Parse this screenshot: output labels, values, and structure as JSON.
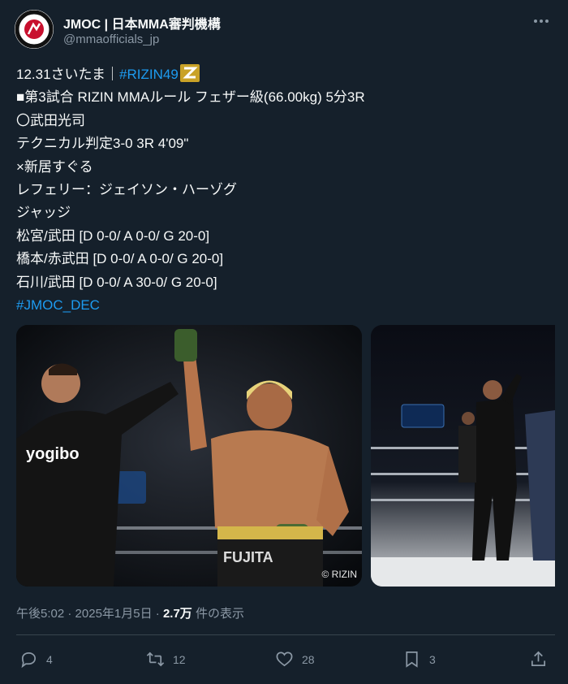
{
  "author": {
    "display_name": "JMOC | 日本MMA審判機構",
    "handle": "@mmaofficials_jp"
  },
  "tweet": {
    "lines": [
      {
        "text": "12.31さいたま｜"
      },
      {
        "text": "■第3試合 RIZIN MMAルール フェザー級(66.00kg) 5分3R"
      },
      {
        "text": "〇武田光司"
      },
      {
        "text": "テクニカル判定3-0  3R 4'09\""
      },
      {
        "text": "×新居すぐる"
      },
      {
        "text": "レフェリー：ジェイソン・ハーゾグ"
      },
      {
        "text": "ジャッジ"
      },
      {
        "text": "松宮/武田 [D 0-0/ A 0-0/ G 20-0]"
      },
      {
        "text": "橋本/赤武田 [D 0-0/ A 0-0/ G 20-0]"
      },
      {
        "text": "石川/武田 [D 0-0/ A 30-0/ G 20-0]"
      }
    ],
    "hashtag_rizin": "#RIZIN49",
    "hashtag_jmoc": "#JMOC_DEC"
  },
  "media": {
    "photo1_copyright": "© RIZIN"
  },
  "meta": {
    "time": "午後5:02",
    "separator1": " · ",
    "date": "2025年1月5日",
    "separator2": " · ",
    "views": "2.7万",
    "views_label": " 件の表示"
  },
  "actions": {
    "reply_count": "4",
    "retweet_count": "12",
    "like_count": "28",
    "bookmark_count": "3"
  },
  "colors": {
    "background": "#15202b",
    "accent": "#1d9bf0",
    "muted": "#8b98a5"
  }
}
